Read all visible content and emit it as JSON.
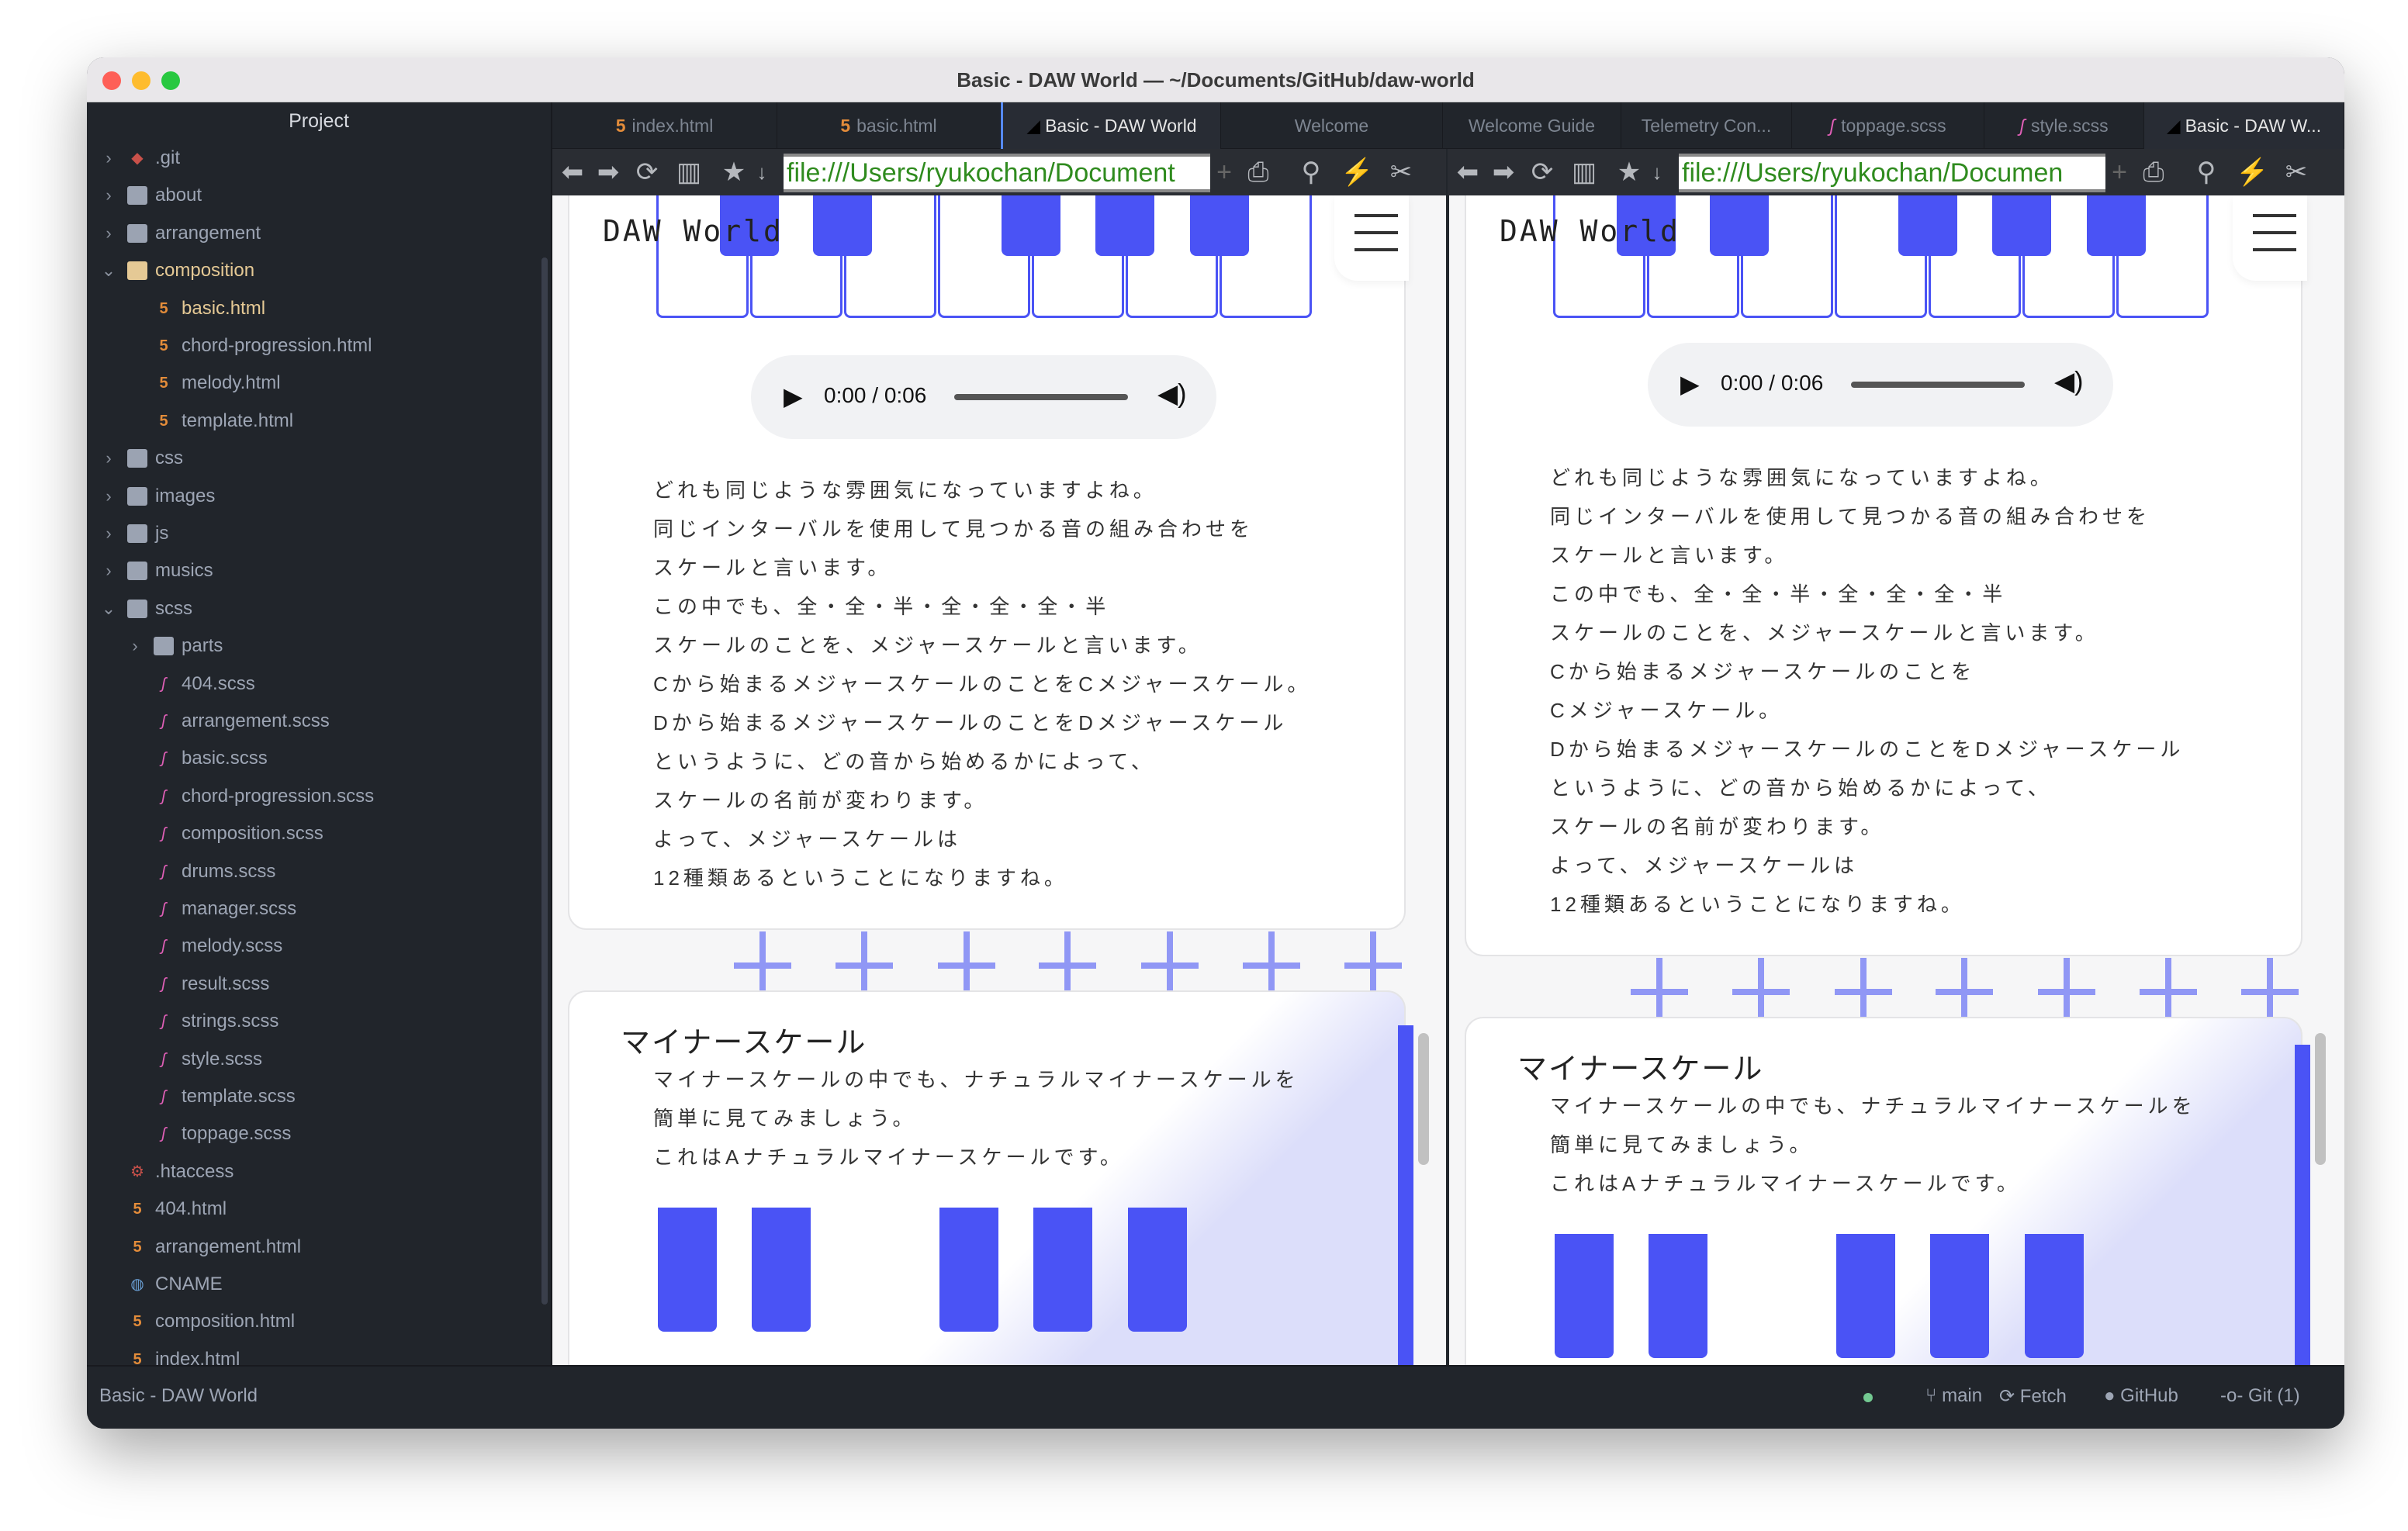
{
  "window": {
    "title": "Basic - DAW World — ~/Documents/GitHub/daw-world",
    "traffic_colors": [
      "#fe5f57",
      "#febc2e",
      "#28c840"
    ]
  },
  "sidebar": {
    "header": "Project",
    "items": [
      {
        "label": ".git",
        "type": "git",
        "level": 0,
        "chevron": "right"
      },
      {
        "label": "about",
        "type": "folder",
        "level": 0,
        "chevron": "right"
      },
      {
        "label": "arrangement",
        "type": "folder",
        "level": 0,
        "chevron": "right"
      },
      {
        "label": "composition",
        "type": "folder-open",
        "level": 0,
        "chevron": "down"
      },
      {
        "label": "basic.html",
        "type": "html",
        "level": 1,
        "selected": true
      },
      {
        "label": "chord-progression.html",
        "type": "html",
        "level": 1
      },
      {
        "label": "melody.html",
        "type": "html",
        "level": 1
      },
      {
        "label": "template.html",
        "type": "html",
        "level": 1
      },
      {
        "label": "css",
        "type": "folder",
        "level": 0,
        "chevron": "right"
      },
      {
        "label": "images",
        "type": "folder",
        "level": 0,
        "chevron": "right"
      },
      {
        "label": "js",
        "type": "folder",
        "level": 0,
        "chevron": "right"
      },
      {
        "label": "musics",
        "type": "folder",
        "level": 0,
        "chevron": "right"
      },
      {
        "label": "scss",
        "type": "folder",
        "level": 0,
        "chevron": "down"
      },
      {
        "label": "parts",
        "type": "folder",
        "level": 1,
        "chevron": "right"
      },
      {
        "label": "404.scss",
        "type": "sass",
        "level": 1
      },
      {
        "label": "arrangement.scss",
        "type": "sass",
        "level": 1
      },
      {
        "label": "basic.scss",
        "type": "sass",
        "level": 1
      },
      {
        "label": "chord-progression.scss",
        "type": "sass",
        "level": 1
      },
      {
        "label": "composition.scss",
        "type": "sass",
        "level": 1
      },
      {
        "label": "drums.scss",
        "type": "sass",
        "level": 1
      },
      {
        "label": "manager.scss",
        "type": "sass",
        "level": 1
      },
      {
        "label": "melody.scss",
        "type": "sass",
        "level": 1
      },
      {
        "label": "result.scss",
        "type": "sass",
        "level": 1
      },
      {
        "label": "strings.scss",
        "type": "sass",
        "level": 1
      },
      {
        "label": "style.scss",
        "type": "sass",
        "level": 1
      },
      {
        "label": "template.scss",
        "type": "sass",
        "level": 1
      },
      {
        "label": "toppage.scss",
        "type": "sass",
        "level": 1
      },
      {
        "label": ".htaccess",
        "type": "gear",
        "level": 0
      },
      {
        "label": "404.html",
        "type": "html",
        "level": 0
      },
      {
        "label": "arrangement.html",
        "type": "html",
        "level": 0
      },
      {
        "label": "CNAME",
        "type": "globe",
        "level": 0
      },
      {
        "label": "composition.html",
        "type": "html",
        "level": 0
      },
      {
        "label": "index.html",
        "type": "html",
        "level": 0
      }
    ]
  },
  "tabs": [
    {
      "label": "index.html",
      "icon": "html"
    },
    {
      "label": "basic.html",
      "icon": "html"
    },
    {
      "label": "Basic - DAW World",
      "icon": "browser",
      "active": true
    },
    {
      "label": "Welcome"
    },
    {
      "label": "Welcome Guide"
    },
    {
      "label": "Telemetry Con..."
    },
    {
      "label": "toppage.scss",
      "icon": "sass"
    },
    {
      "label": "style.scss",
      "icon": "sass"
    },
    {
      "label": "Basic - DAW W...",
      "icon": "browser",
      "active": true
    }
  ],
  "toolbar": {
    "url": "file:///Users/ryukochan/Document",
    "url2": "file:///Users/ryukochan/Documen",
    "icons": [
      "back-icon",
      "forward-icon",
      "refresh-icon",
      "reader-icon",
      "star-icon",
      "dropdown-icon",
      "add-icon",
      "print-icon",
      "pin-icon",
      "lightning-icon",
      "tools-icon"
    ]
  },
  "panes": [
    {
      "logo": "DAW World",
      "audio_time": "0:00 / 0:06",
      "lines": [
        "どれも同じような雰囲気になっていますよね。",
        "同じインターバルを使用して見つかる音の組み合わせを",
        "スケールと言います。",
        "この中でも、全・全・半・全・全・全・半",
        "スケールのことを、メジャースケールと言います。",
        "Cから始まるメジャースケールのことをCメジャースケール。",
        "Dから始まるメジャースケールのことをDメジャースケール",
        "というように、どの音から始めるかによって、",
        "スケールの名前が変わります。",
        "よって、メジャースケールは",
        "12種類あるということになりますね。"
      ],
      "minor_title": "マイナースケール",
      "minor_lines": [
        "マイナースケールの中でも、ナチュラルマイナースケールを",
        "簡単に見てみましょう。",
        "これはAナチュラルマイナースケールです。"
      ]
    },
    {
      "logo": "DAW World",
      "audio_time": "0:00 / 0:06",
      "lines": [
        "どれも同じような雰囲気になっていますよね。",
        "同じインターバルを使用して見つかる音の組み合わせを",
        "スケールと言います。",
        "この中でも、全・全・半・全・全・全・半",
        "スケールのことを、メジャースケールと言います。",
        "Cから始まるメジャースケールのことを",
        "Cメジャースケール。",
        "Dから始まるメジャースケールのことをDメジャースケール",
        "というように、どの音から始めるかによって、",
        "スケールの名前が変わります。",
        "よって、メジャースケールは",
        "12種類あるということになりますね。"
      ],
      "minor_title": "マイナースケール",
      "minor_lines": [
        "マイナースケールの中でも、ナチュラルマイナースケールを",
        "簡単に見てみましょう。",
        "これはAナチュラルマイナースケールです。"
      ]
    }
  ],
  "status": {
    "left": "Basic - DAW World",
    "branch": "main",
    "fetch": "Fetch",
    "github": "GitHub",
    "git": "Git (1)",
    "dot_color": "#73c991"
  },
  "colors": {
    "accent": "#4a53f5",
    "cross": "#9097f5",
    "url": "#2f8b1e"
  }
}
